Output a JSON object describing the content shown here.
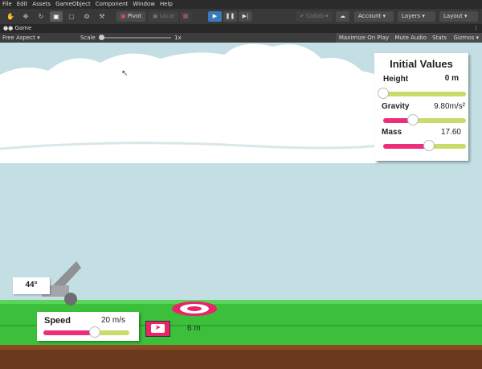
{
  "menu": [
    "File",
    "Edit",
    "Assets",
    "GameObject",
    "Component",
    "Window",
    "Help"
  ],
  "toolbar": {
    "tools": [
      {
        "name": "hand-tool-icon",
        "glyph": "✋",
        "active": false
      },
      {
        "name": "move-tool-icon",
        "glyph": "✥",
        "active": false
      },
      {
        "name": "rotate-tool-icon",
        "glyph": "↻",
        "active": false
      },
      {
        "name": "scale-tool-icon",
        "glyph": "▣",
        "active": true
      },
      {
        "name": "rect-tool-icon",
        "glyph": "▢",
        "active": false
      },
      {
        "name": "transform-tool-icon",
        "glyph": "⭗",
        "active": false
      },
      {
        "name": "custom-tool-icon",
        "glyph": "⚒",
        "active": false
      }
    ],
    "pivot": "Pivot",
    "local": "Local",
    "collab": "Collab",
    "account": "Account",
    "layers": "Layers",
    "layout": "Layout"
  },
  "game_tab": {
    "title": "Game"
  },
  "game_bar": {
    "aspect": "Free Aspect",
    "scale_label": "Scale",
    "scale_value": "1x",
    "maximize": "Maximize On Play",
    "mute": "Mute Audio",
    "stats": "Stats",
    "gizmos": "Gizmos"
  },
  "initial_values": {
    "title": "Initial Values",
    "height": {
      "label": "Height",
      "value": "0 m",
      "fraction": 0.0
    },
    "gravity": {
      "label": "Gravity",
      "value": "9.80m/s²",
      "fraction": 0.36
    },
    "mass": {
      "label": "Mass",
      "value": "17.60",
      "fraction": 0.55
    }
  },
  "cannon": {
    "angle": "44°"
  },
  "speed": {
    "label": "Speed",
    "value": "20 m/s",
    "fraction": 0.6
  },
  "target": {
    "distance": "6 m"
  },
  "colors": {
    "accent": "#ec2e7b",
    "track": "#c8dc6c",
    "grass": "#3cc03c",
    "sky": "#c3dfe3"
  }
}
